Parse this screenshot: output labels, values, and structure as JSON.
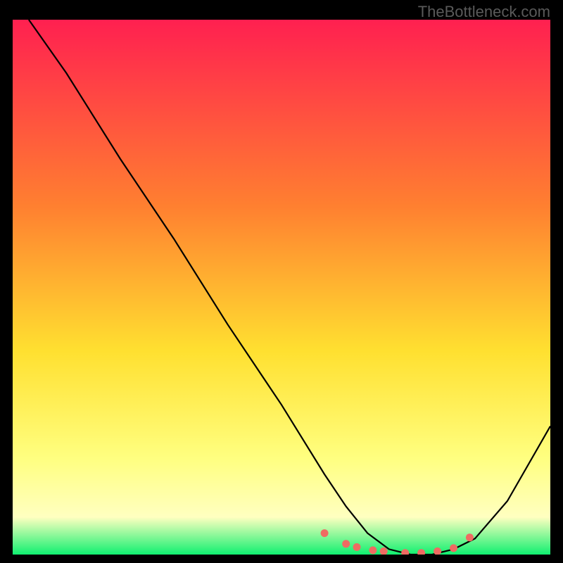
{
  "watermark": "TheBottleneck.com",
  "colors": {
    "gradient_top": "#ff2050",
    "gradient_mid1": "#ff8030",
    "gradient_mid2": "#ffe030",
    "gradient_bottom_yellow": "#ffff80",
    "gradient_green": "#10f070",
    "curve": "#000000",
    "markers": "#ef6b62",
    "frame_bg": "#000000"
  },
  "chart_data": {
    "type": "line",
    "title": "",
    "xlabel": "",
    "ylabel": "",
    "xlim": [
      0,
      100
    ],
    "ylim": [
      0,
      100
    ],
    "series": [
      {
        "name": "bottleneck-curve",
        "x": [
          3,
          10,
          20,
          30,
          40,
          50,
          58,
          62,
          66,
          70,
          74,
          78,
          82,
          86,
          92,
          100
        ],
        "y": [
          100,
          90,
          74,
          59,
          43,
          28,
          15,
          9,
          4,
          1,
          0,
          0,
          1,
          3,
          10,
          24
        ]
      }
    ],
    "markers": {
      "name": "highlight-points",
      "x": [
        58,
        62,
        64,
        67,
        69,
        73,
        76,
        79,
        82,
        85
      ],
      "y": [
        4,
        2,
        1.4,
        0.8,
        0.6,
        0.3,
        0.3,
        0.6,
        1.2,
        3.2
      ]
    }
  }
}
